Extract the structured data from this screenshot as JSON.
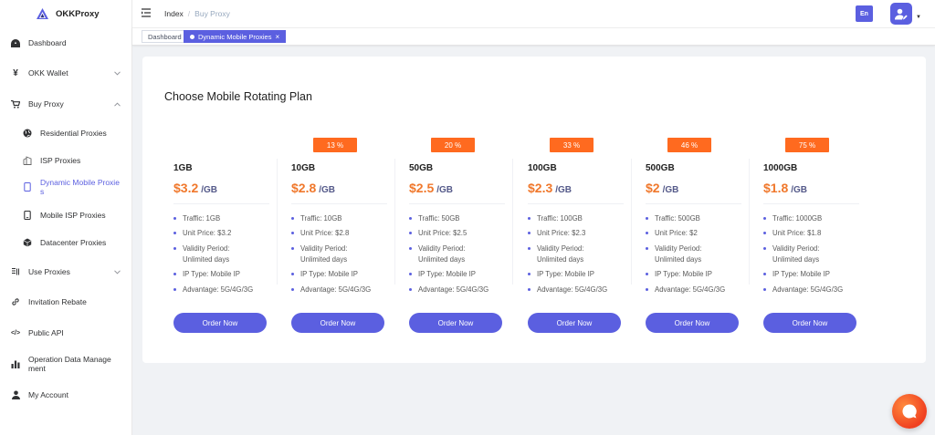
{
  "brand": {
    "name": "OKKProxy"
  },
  "sidebar": {
    "items": [
      {
        "label": "Dashboard"
      },
      {
        "label": "OKK Wallet"
      },
      {
        "label": "Buy Proxy"
      },
      {
        "label": "Residential Proxies"
      },
      {
        "label": "ISP Proxies"
      },
      {
        "label": "Dynamic Mobile Proxies"
      },
      {
        "label": "Mobile ISP Proxies"
      },
      {
        "label": "Datacenter Proxies"
      },
      {
        "label": "Use Proxies"
      },
      {
        "label": "Invitation Rebate"
      },
      {
        "label": "Public API"
      },
      {
        "label": "Operation Data Management"
      },
      {
        "label": "My Account"
      }
    ]
  },
  "header": {
    "breadcrumb_home": "Index",
    "breadcrumb_sep": "/",
    "breadcrumb_current": "Buy Proxy",
    "lang_label": "En"
  },
  "tags": {
    "dashboard": "Dashboard",
    "active": "Dynamic Mobile Proxies",
    "close": "×"
  },
  "main": {
    "title": "Choose Mobile Rotating Plan",
    "order_label": "Order Now",
    "plans": [
      {
        "name": "1GB",
        "price": "$3.2",
        "unit": "/GB",
        "discount": null,
        "features": [
          "Traffic: 1GB",
          "Unit Price: $3.2",
          "Validity Period: Unlimited days",
          "IP Type: Mobile IP",
          "Advantage: 5G/4G/3G"
        ]
      },
      {
        "name": "10GB",
        "price": "$2.8",
        "unit": "/GB",
        "discount": "13 %",
        "features": [
          "Traffic: 10GB",
          "Unit Price: $2.8",
          "Validity Period: Unlimited days",
          "IP Type: Mobile IP",
          "Advantage: 5G/4G/3G"
        ]
      },
      {
        "name": "50GB",
        "price": "$2.5",
        "unit": "/GB",
        "discount": "20 %",
        "features": [
          "Traffic: 50GB",
          "Unit Price: $2.5",
          "Validity Period: Unlimited days",
          "IP Type: Mobile IP",
          "Advantage: 5G/4G/3G"
        ]
      },
      {
        "name": "100GB",
        "price": "$2.3",
        "unit": "/GB",
        "discount": "33 %",
        "features": [
          "Traffic: 100GB",
          "Unit Price: $2.3",
          "Validity Period: Unlimited days",
          "IP Type: Mobile IP",
          "Advantage: 5G/4G/3G"
        ]
      },
      {
        "name": "500GB",
        "price": "$2",
        "unit": "/GB",
        "discount": "46 %",
        "features": [
          "Traffic: 500GB",
          "Unit Price: $2",
          "Validity Period: Unlimited days",
          "IP Type: Mobile IP",
          "Advantage: 5G/4G/3G"
        ]
      },
      {
        "name": "1000GB",
        "price": "$1.8",
        "unit": "/GB",
        "discount": "75 %",
        "features": [
          "Traffic: 1000GB",
          "Unit Price: $1.8",
          "Validity Period: Unlimited days",
          "IP Type: Mobile IP",
          "Advantage: 5G/4G/3G"
        ]
      }
    ]
  },
  "colors": {
    "accent": "#5b5fe0",
    "discount": "#ff6a1f",
    "price": "#f0782c"
  }
}
